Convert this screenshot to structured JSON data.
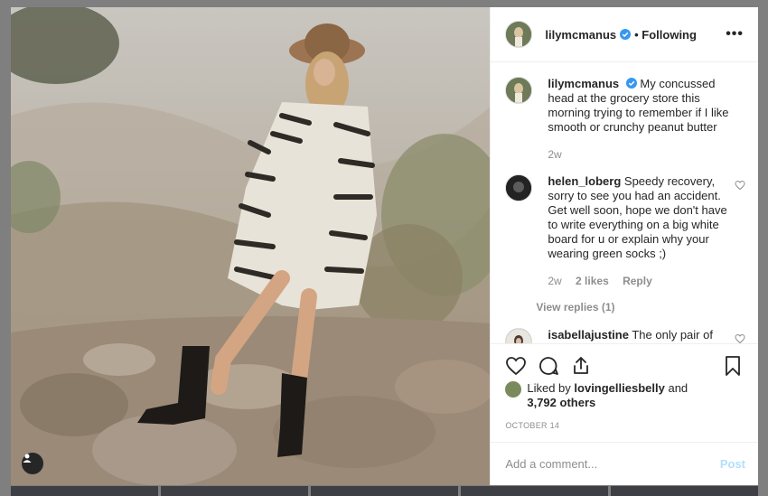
{
  "post": {
    "author": "lilymcmanus",
    "follow_state": "• Following",
    "more_icon": "•••",
    "caption": {
      "username": "lilymcmanus",
      "text": "My concussed head at the grocery store this morning trying to remember if I like smooth or crunchy peanut butter",
      "time": "2w"
    },
    "comments": [
      {
        "username": "helen_loberg",
        "text": "Speedy recovery, sorry to see you had an accident. Get well soon, hope we don't have to write everything on a big white board for u or explain why your wearing green socks ;)",
        "time": "2w",
        "likes": "2 likes",
        "reply": "Reply",
        "view_replies": "View replies (1)"
      },
      {
        "username": "isabellajustine",
        "text": "The only pair of underwear you own 😂"
      }
    ],
    "liked_by_prefix": "Liked by",
    "liked_by_user": "lovingelliesbelly",
    "liked_by_and": "and",
    "liked_by_others": "3,792 others",
    "date": "OCTOBER 14",
    "add_comment_placeholder": "Add a comment...",
    "post_button": "Post",
    "icons": [
      "heart-icon",
      "comment-icon",
      "share-icon",
      "bookmark-icon",
      "verified-badge-icon",
      "user-tag-icon"
    ]
  },
  "colors": {
    "text": "#262626",
    "muted": "#8e8e8e",
    "verified": "#3897f0",
    "post_disabled": "#b2dffc",
    "backdrop": "#7f7f7f"
  }
}
